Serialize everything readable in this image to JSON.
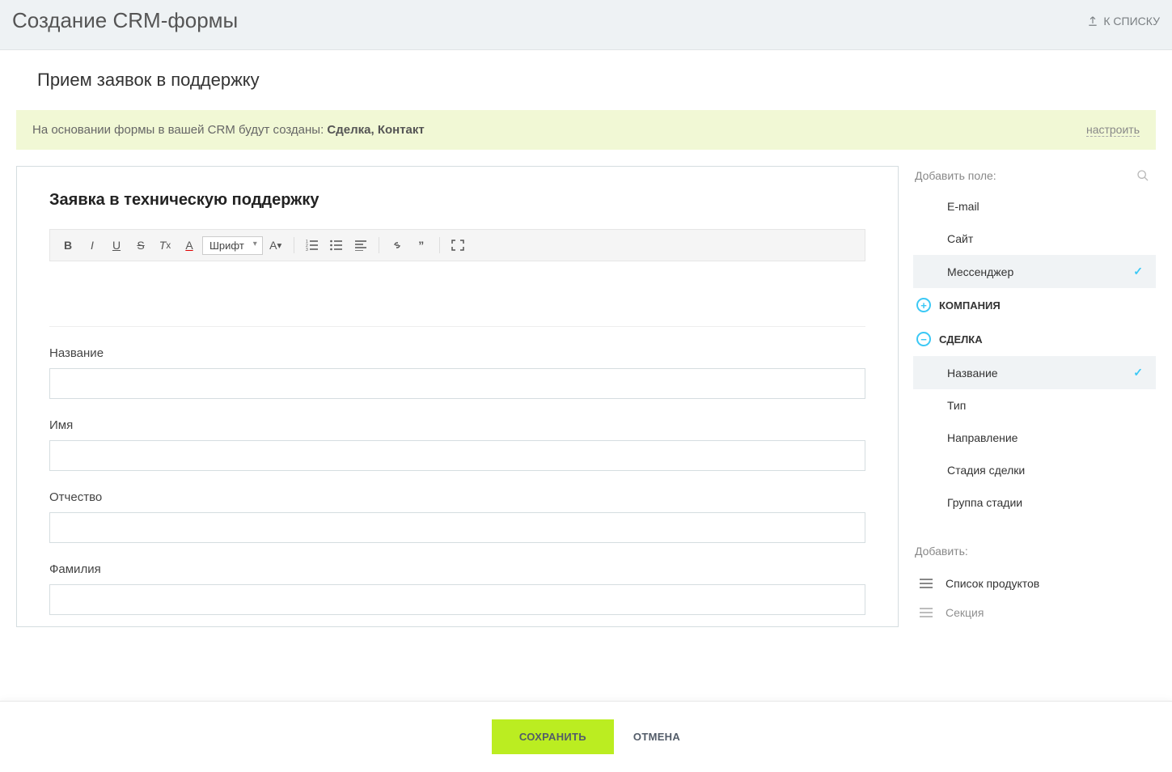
{
  "header": {
    "title": "Создание CRM-формы",
    "back": "К СПИСКУ"
  },
  "subtitle": "Прием заявок в поддержку",
  "info": {
    "prefix": "На основании формы в вашей CRM будут созданы: ",
    "entities": "Сделка, Контакт",
    "configure": "настроить"
  },
  "editor": {
    "heading": "Заявка в техническую поддержку",
    "font_label": "Шрифт",
    "fields": [
      {
        "label": "Название"
      },
      {
        "label": "Имя"
      },
      {
        "label": "Отчество"
      },
      {
        "label": "Фамилия"
      }
    ]
  },
  "sidebar": {
    "search_label": "Добавить поле:",
    "items": [
      {
        "label": "E-mail",
        "selected": false
      },
      {
        "label": "Сайт",
        "selected": false
      },
      {
        "label": "Мессенджер",
        "selected": true
      }
    ],
    "group_company": "КОМПАНИЯ",
    "group_deal": "СДЕЛКА",
    "deal_items": [
      {
        "label": "Название",
        "selected": true
      },
      {
        "label": "Тип",
        "selected": false
      },
      {
        "label": "Направление",
        "selected": false
      },
      {
        "label": "Стадия сделки",
        "selected": false
      },
      {
        "label": "Группа стадии",
        "selected": false
      }
    ],
    "add_label": "Добавить:",
    "add_options": [
      "Список продуктов",
      "Секция"
    ]
  },
  "footer": {
    "save": "СОХРАНИТЬ",
    "cancel": "ОТМЕНА"
  }
}
